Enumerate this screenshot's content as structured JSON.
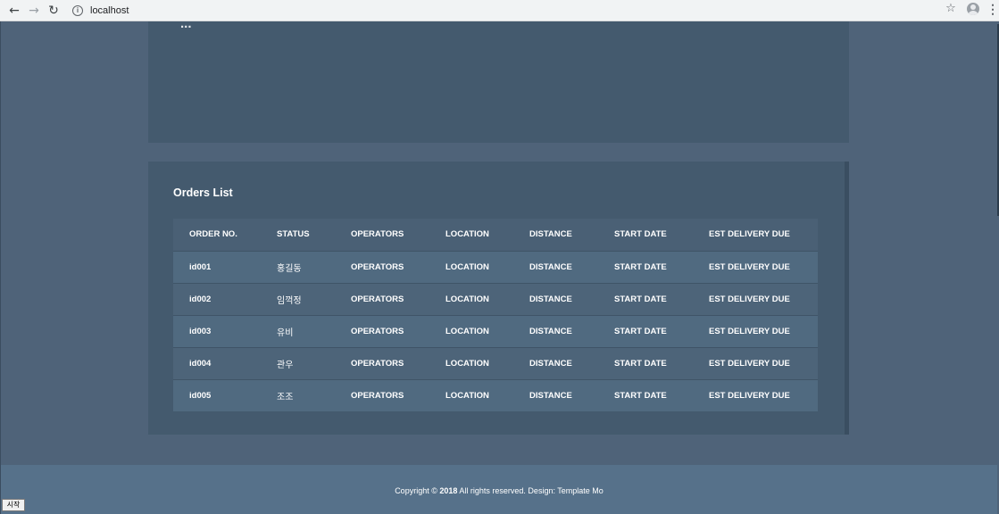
{
  "browser": {
    "url": "localhost",
    "icons": {
      "back": "arrow-left-icon",
      "forward": "arrow-right-icon",
      "reload": "reload-icon",
      "info": "info-icon",
      "star": "star-icon",
      "profile": "profile-icon",
      "menu": "kebab-menu-icon"
    }
  },
  "top_panel": {
    "partial_title": "..."
  },
  "orders": {
    "title": "Orders List",
    "columns": [
      "ORDER NO.",
      "STATUS",
      "OPERATORS",
      "LOCATION",
      "DISTANCE",
      "START DATE",
      "EST DELIVERY DUE"
    ],
    "rows": [
      {
        "order_no": "id001",
        "status": "홍길동",
        "operators": "OPERATORS",
        "location": "LOCATION",
        "distance": "DISTANCE",
        "start_date": "START DATE",
        "est_due": "EST DELIVERY DUE"
      },
      {
        "order_no": "id002",
        "status": "임꺽정",
        "operators": "OPERATORS",
        "location": "LOCATION",
        "distance": "DISTANCE",
        "start_date": "START DATE",
        "est_due": "EST DELIVERY DUE"
      },
      {
        "order_no": "id003",
        "status": "유비",
        "operators": "OPERATORS",
        "location": "LOCATION",
        "distance": "DISTANCE",
        "start_date": "START DATE",
        "est_due": "EST DELIVERY DUE"
      },
      {
        "order_no": "id004",
        "status": "관우",
        "operators": "OPERATORS",
        "location": "LOCATION",
        "distance": "DISTANCE",
        "start_date": "START DATE",
        "est_due": "EST DELIVERY DUE"
      },
      {
        "order_no": "id005",
        "status": "조조",
        "operators": "OPERATORS",
        "location": "LOCATION",
        "distance": "DISTANCE",
        "start_date": "START DATE",
        "est_due": "EST DELIVERY DUE"
      }
    ]
  },
  "footer": {
    "prefix": "Copyright ©",
    "year": "2018",
    "suffix": "All rights reserved. Design: Template Mo"
  },
  "taskbar": {
    "start_label": "시작"
  },
  "colors": {
    "page_bg": "#4f6379",
    "panel_bg": "#445a6e",
    "footer_bg": "#56718a"
  }
}
